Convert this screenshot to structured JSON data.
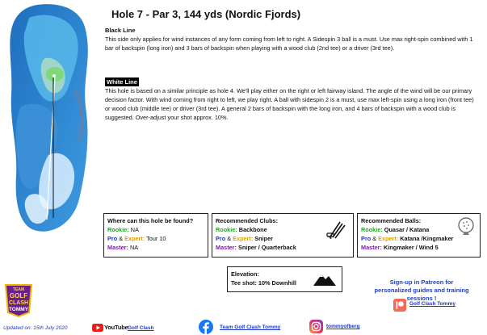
{
  "header": {
    "title": "Hole 7 - Par 3, 144 yds (Nordic Fjords)"
  },
  "black_line": {
    "heading": "Black Line",
    "text": "This side only applies for wind instances of any form coming from left to right. A Sidespin 3 ball is a must. Use max right-spin combined with 1 bar of backspin (long iron) and 3 bars of backspin when playing with a wood club (2nd tee) or a driver (3rd tee)."
  },
  "white_line": {
    "heading": "White Line",
    "text": "This hole is based on a similar principle as hole 4. We'll play either on the right or left fairway island. The angle of the wind will be our primary decision factor. With wind coming from right to left, we play right. A ball with sidespin 2 is a must, use max left-spin using a long iron (front tee) or wood club (middle tee) or driver (3rd tee). A general 2 bars of backspin with the long iron, and 4 bars of backspin with a wood club is suggested. Over-adjust your shot approx. 10%."
  },
  "location_box": {
    "heading": "Where can this hole be found?",
    "rookie_label": "Rookie:",
    "rookie_value": "NA",
    "pro_label": "Pro",
    "amp": "&",
    "expert_label": "Expert:",
    "pro_expert_value": "Tour 10",
    "master_label": "Master:",
    "master_value": "NA"
  },
  "clubs_box": {
    "heading": "Recommended Clubs:",
    "rookie_label": "Rookie:",
    "rookie_value": "Backbone",
    "pro_label": "Pro",
    "amp": "&",
    "expert_label": "Expert:",
    "pro_expert_value": "Sniper",
    "master_label": "Master:",
    "master_value": "Sniper / Quarterback",
    "icon": "golf-clubs-icon"
  },
  "balls_box": {
    "heading": "Recommended Balls:",
    "rookie_label": "Rookie:",
    "rookie_value": "Quasar / Katana",
    "pro_label": "Pro",
    "amp": "&",
    "expert_label": "Expert:",
    "pro_expert_value": "Katana /Kingmaker",
    "master_label": "Master:",
    "master_value": "Kingmaker / Wind 5",
    "icon": "golf-ball-icon"
  },
  "elevation_box": {
    "heading": "Elevation:",
    "value": "Tee shot: 10% Downhill",
    "icon": "mountain-icon"
  },
  "patreon": {
    "promo": "Sign-up in Patreon for personalized guides and training sessions !",
    "link": "Golf Clash Tommy",
    "icon": "patreon-icon"
  },
  "logo": {
    "line1": "TEAM",
    "line2": "GOLF",
    "line3": "CLASH",
    "line4": "TOMMY"
  },
  "footer": {
    "updated": "Updated on: 15th July 2020",
    "youtube_word": "YouTube",
    "youtube_link": "Golf Clash",
    "facebook_link": "Team Golf Clash Tommy",
    "instagram_link": "tommyofberg"
  },
  "colors": {
    "rookie": "#22a32a",
    "pro": "#1a36d4",
    "expert": "#e5a000",
    "master": "#7b1fa2",
    "water": "#2b7fc9",
    "fairway": "#9fd6c7",
    "green": "#7fd87a"
  }
}
